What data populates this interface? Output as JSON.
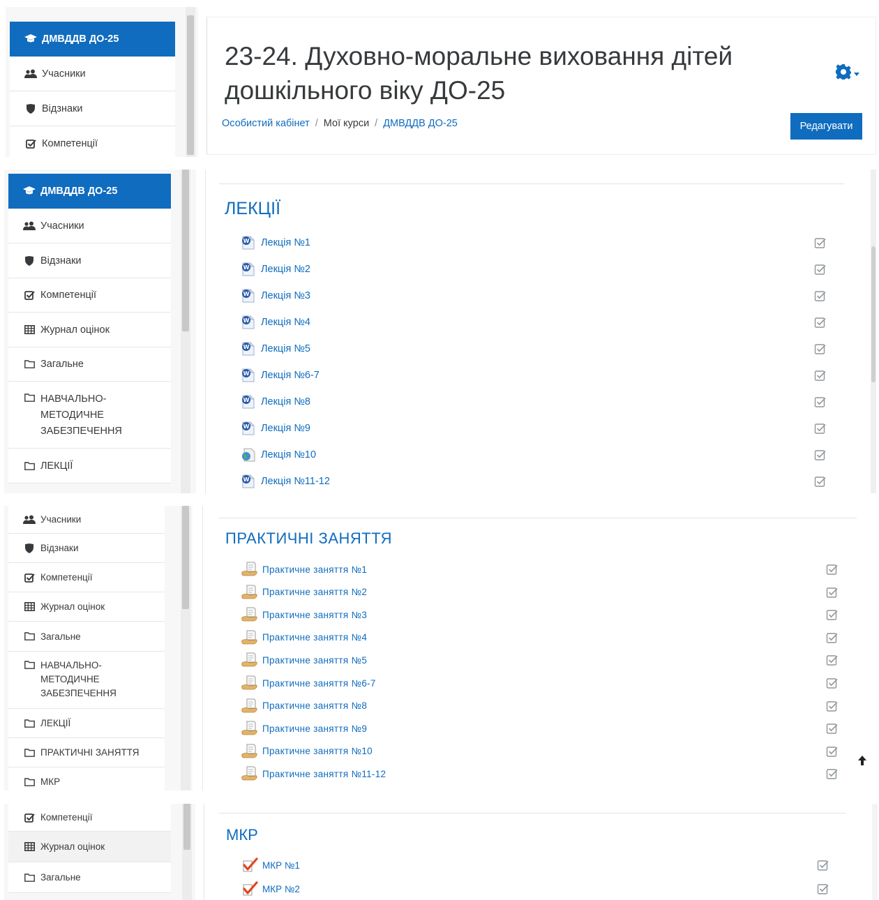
{
  "course": {
    "title": "23-24. Духовно-моральне виховання дітей дошкільного віку ДО-25",
    "short_name": "ДМВДДВ ДО-25"
  },
  "breadcrumb": {
    "home": "Особистий кабінет",
    "my_courses": "Мої курси",
    "current": "ДМВДДВ ДО-25"
  },
  "buttons": {
    "edit": "Редагувати"
  },
  "nav": {
    "participants": "Учасники",
    "badges": "Відзнаки",
    "competencies": "Компетенції",
    "grades": "Журнал оцінок",
    "general": "Загальне",
    "methodical_line1": "НАВЧАЛЬНО-",
    "methodical_line2": "МЕТОДИЧНЕ",
    "methodical_line3": "ЗАБЕЗПЕЧЕННЯ",
    "lectures": "ЛЕКЦІЇ",
    "practicals": "ПРАКТИЧНІ ЗАНЯТТЯ",
    "mkr": "МКР"
  },
  "sections": {
    "lectures": {
      "title": "ЛЕКЦІЇ",
      "items": [
        "Лекція №1",
        "Лекція №2",
        "Лекція №3",
        "Лекція №4",
        "Лекція №5",
        "Лекція №6-7",
        "Лекція №8",
        "Лекція №9",
        "Лекція №10",
        "Лекція №11-12"
      ]
    },
    "practicals": {
      "title": "ПРАКТИЧНІ ЗАНЯТТЯ",
      "items": [
        "Практичне заняття №1",
        "Практичне заняття №2",
        "Практичне заняття №3",
        "Практичне заняття №4",
        "Практичне заняття №5",
        "Практичне заняття №6-7",
        "Практичне заняття №8",
        "Практичне заняття №9",
        "Практичне заняття №10",
        "Практичне заняття №11-12"
      ]
    },
    "mkr": {
      "title": "МКР",
      "items": [
        "МКР №1",
        "МКР №2"
      ]
    }
  },
  "colors": {
    "brand": "#0f6cbf",
    "text": "#373a3c",
    "muted": "#868e96"
  },
  "icons": [
    "graduation-cap-icon",
    "users-icon",
    "shield-icon",
    "check-square-icon",
    "table-icon",
    "folder-icon",
    "gear-icon",
    "word-doc-icon",
    "globe-doc-icon",
    "assignment-icon",
    "quiz-icon",
    "completion-check-icon",
    "arrow-up-icon"
  ]
}
